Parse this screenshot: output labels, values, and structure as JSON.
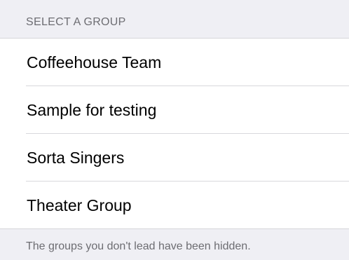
{
  "section": {
    "header": "SELECT A GROUP"
  },
  "groups": [
    {
      "label": "Coffeehouse Team"
    },
    {
      "label": "Sample for testing"
    },
    {
      "label": "Sorta Singers"
    },
    {
      "label": "Theater Group"
    }
  ],
  "footer": {
    "note": "The groups you don't lead have been hidden."
  }
}
